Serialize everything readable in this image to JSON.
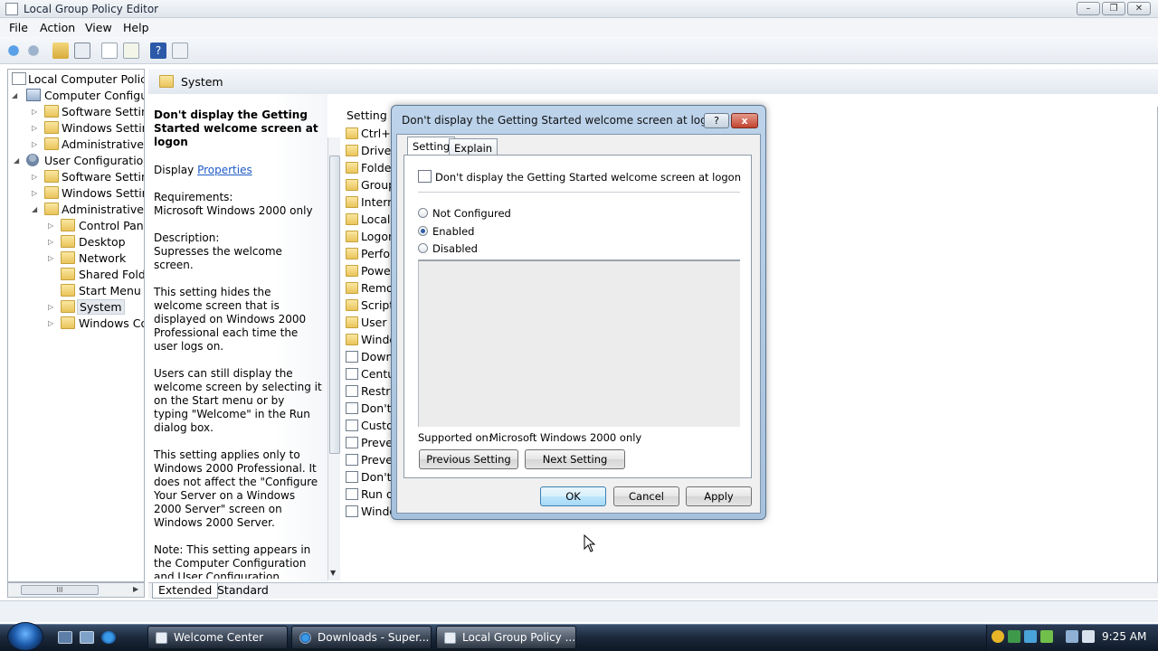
{
  "window": {
    "title": "Local Group Policy Editor"
  },
  "menu": [
    "File",
    "Action",
    "View",
    "Help"
  ],
  "tree": [
    {
      "label": "Local Computer Policy",
      "icon": "policy-doc-icon"
    },
    {
      "label": "Computer Configura",
      "icon": "computer-icon"
    },
    {
      "label": "Software Settings",
      "icon": "folder-icon"
    },
    {
      "label": "Windows Setting",
      "icon": "folder-icon"
    },
    {
      "label": "Administrative Te",
      "icon": "folder-icon"
    },
    {
      "label": "User Configuration",
      "icon": "user-icon"
    },
    {
      "label": "Software Settings",
      "icon": "folder-icon"
    },
    {
      "label": "Windows Setting",
      "icon": "folder-icon"
    },
    {
      "label": "Administrative Te",
      "icon": "folder-icon"
    },
    {
      "label": "Control Panel",
      "icon": "folder-icon"
    },
    {
      "label": "Desktop",
      "icon": "folder-icon"
    },
    {
      "label": "Network",
      "icon": "folder-icon"
    },
    {
      "label": "Shared Folder",
      "icon": "folder-icon"
    },
    {
      "label": "Start Menu ar",
      "icon": "folder-icon"
    },
    {
      "label": "System",
      "icon": "folder-icon"
    },
    {
      "label": "Windows Cor",
      "icon": "folder-icon"
    }
  ],
  "tree_hscroll_grip": "III",
  "panel": {
    "header": "System",
    "setting_column": "Setting",
    "desc_title": "Don't display the Getting Started welcome screen at logon",
    "display_label": "Display",
    "properties_link": "Properties",
    "requirements_label": "Requirements:",
    "requirements_value": "Microsoft Windows 2000 only",
    "description_label": "Description:",
    "description_value": "Supresses the welcome screen.",
    "para1": "This setting hides the welcome screen that is displayed on Windows 2000 Professional each time the user logs on.",
    "para2": "Users can still display the welcome screen by selecting it on the Start menu or by typing \"Welcome\" in the Run dialog box.",
    "para3": "This setting applies only to Windows 2000 Professional. It does not affect the \"Configure Your Server on a Windows 2000 Server\" screen on Windows 2000 Server.",
    "para4": "Note: This setting appears in the Computer Configuration and User Configuration folders. If both settings are configured, the setting in Computer Configuration takes precedence over the setting in User"
  },
  "settings": [
    {
      "label": "Ctrl+A",
      "icon": "folder-icon"
    },
    {
      "label": "Driver",
      "icon": "folder-icon"
    },
    {
      "label": "Folder",
      "icon": "folder-icon"
    },
    {
      "label": "Group",
      "icon": "folder-icon"
    },
    {
      "label": "Interne",
      "icon": "folder-icon"
    },
    {
      "label": "Locale",
      "icon": "folder-icon"
    },
    {
      "label": "Logon",
      "icon": "folder-icon"
    },
    {
      "label": "Perfor",
      "icon": "folder-icon"
    },
    {
      "label": "Power",
      "icon": "folder-icon"
    },
    {
      "label": "Remov",
      "icon": "folder-icon"
    },
    {
      "label": "Scripts",
      "icon": "folder-icon"
    },
    {
      "label": "User P",
      "icon": "folder-icon"
    },
    {
      "label": "Windo",
      "icon": "folder-icon"
    },
    {
      "label": "Downl",
      "icon": "policy-setting-icon"
    },
    {
      "label": "Centu",
      "icon": "policy-setting-icon"
    },
    {
      "label": "Restric",
      "icon": "policy-setting-icon"
    },
    {
      "label": "Don't",
      "icon": "policy-setting-icon"
    },
    {
      "label": "Custor",
      "icon": "policy-setting-icon"
    },
    {
      "label": "Prever",
      "icon": "policy-setting-icon"
    },
    {
      "label": "Prever",
      "icon": "policy-setting-icon"
    },
    {
      "label": "Don't",
      "icon": "policy-setting-icon"
    },
    {
      "label": "Run oi",
      "icon": "policy-setting-icon"
    },
    {
      "label": "Windo",
      "icon": "policy-setting-icon"
    }
  ],
  "bottom_tabs": [
    "Extended",
    "Standard"
  ],
  "dialog": {
    "title": "Don't display the Getting Started welcome screen at logon Pr...",
    "help_glyph": "?",
    "close_glyph": "x",
    "tabs": [
      "Setting",
      "Explain"
    ],
    "policy_title": "Don't display the Getting Started welcome screen at logon",
    "options": [
      "Not Configured",
      "Enabled",
      "Disabled"
    ],
    "selected_option": "Enabled",
    "supported_label": "Supported on:",
    "supported_value": "Microsoft Windows 2000 only",
    "prev_button": "Previous Setting",
    "next_button": "Next Setting",
    "ok": "OK",
    "cancel": "Cancel",
    "apply": "Apply"
  },
  "taskbar": {
    "tasks": [
      "Welcome Center",
      "Downloads - Super...",
      "Local Group Policy ..."
    ],
    "active_task": "Local Group Policy ...",
    "clock": "9:25 AM"
  },
  "colors": {
    "link": "#1f5cc7",
    "dialog_frame": "#a6c1dd",
    "taskbar": "#1c2a3d"
  }
}
